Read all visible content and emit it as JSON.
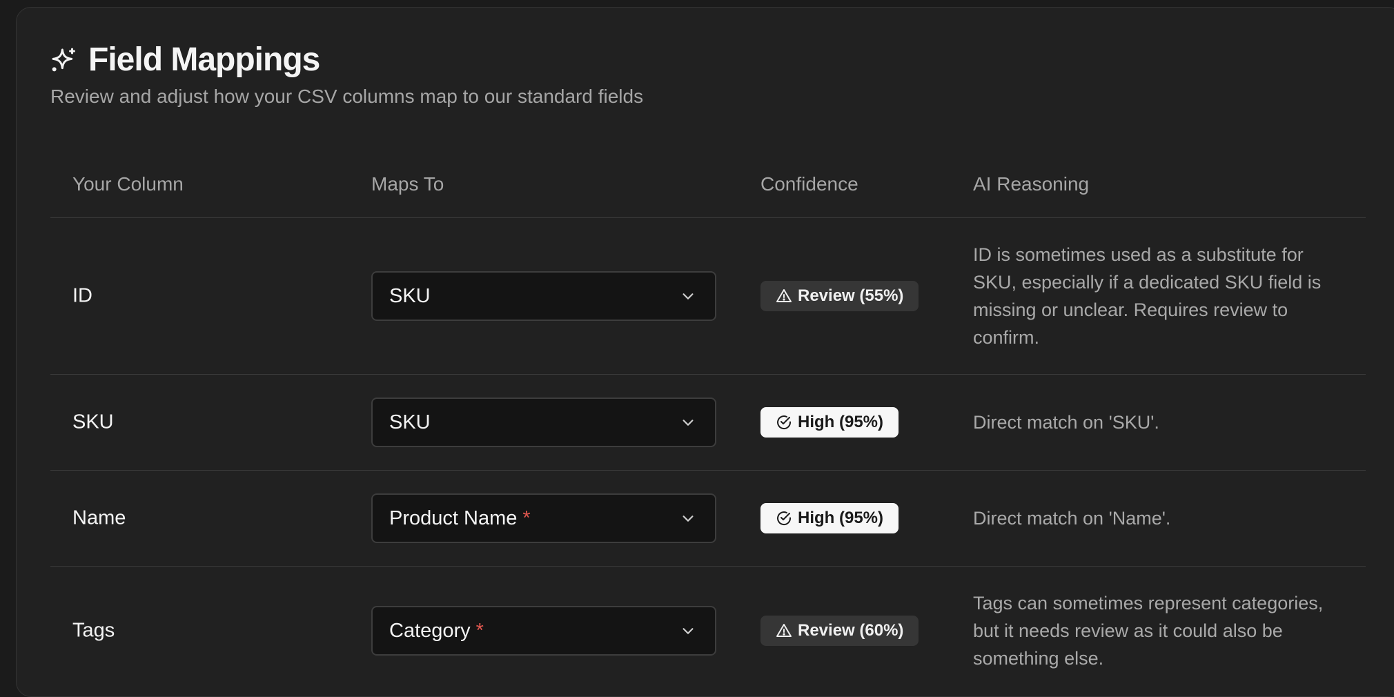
{
  "header": {
    "title": "Field Mappings",
    "subtitle": "Review and adjust how your CSV columns map to our standard fields",
    "icon": "sparkles-icon"
  },
  "table": {
    "columns": [
      "Your Column",
      "Maps To",
      "Confidence",
      "AI Reasoning"
    ],
    "rows": [
      {
        "column": "ID",
        "maps_to": "SKU",
        "required": false,
        "confidence": "Review (55%)",
        "confidence_level": "review",
        "reasoning": "ID is sometimes used as a substitute for SKU, especially if a dedicated SKU field is missing or unclear. Requires review to confirm."
      },
      {
        "column": "SKU",
        "maps_to": "SKU",
        "required": false,
        "confidence": "High (95%)",
        "confidence_level": "high",
        "reasoning": "Direct match on 'SKU'."
      },
      {
        "column": "Name",
        "maps_to": "Product Name",
        "required": true,
        "confidence": "High (95%)",
        "confidence_level": "high",
        "reasoning": "Direct match on 'Name'."
      },
      {
        "column": "Tags",
        "maps_to": "Category",
        "required": true,
        "confidence": "Review (60%)",
        "confidence_level": "review",
        "reasoning": "Tags can sometimes represent categories, but it needs review as it could also be something else."
      }
    ]
  },
  "required_marker": "*",
  "colors": {
    "background": "#212121",
    "required": "#e0574f",
    "badge_high": "#f7f7f7",
    "badge_review": "#363636"
  }
}
